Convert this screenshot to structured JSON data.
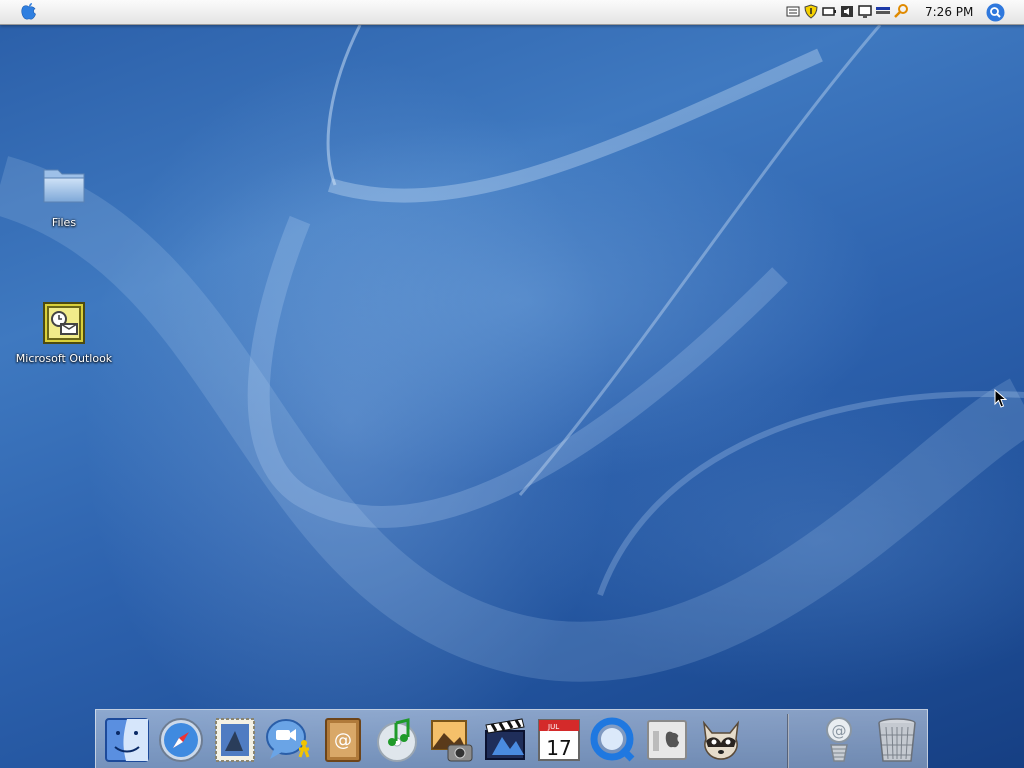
{
  "menubar": {
    "clock": "7:26 PM",
    "tray_icons": [
      "keyboard-icon",
      "security-shield-icon",
      "battery-icon",
      "volume-icon",
      "display-icon",
      "network-icon",
      "search-key-icon"
    ]
  },
  "desktop": {
    "icons": [
      {
        "name": "files-folder-icon",
        "label": "Files"
      },
      {
        "name": "microsoft-outlook-icon",
        "label": "Microsoft Outlook"
      }
    ]
  },
  "dock": {
    "items": [
      "finder-icon",
      "safari-icon",
      "mail-stamp-icon",
      "ichat-icon",
      "address-book-icon",
      "itunes-icon",
      "iphoto-icon",
      "imovie-icon",
      "ical-icon",
      "quicktime-icon",
      "system-preferences-icon",
      "raccoon-app-icon"
    ],
    "right_items": [
      "internet-connect-icon",
      "trash-icon"
    ],
    "ical_month": "JUL",
    "ical_day": "17"
  },
  "colors": {
    "menubar": "#f0f0f0",
    "desktop": "#2d62ae",
    "dock": "#b9c6d8"
  }
}
